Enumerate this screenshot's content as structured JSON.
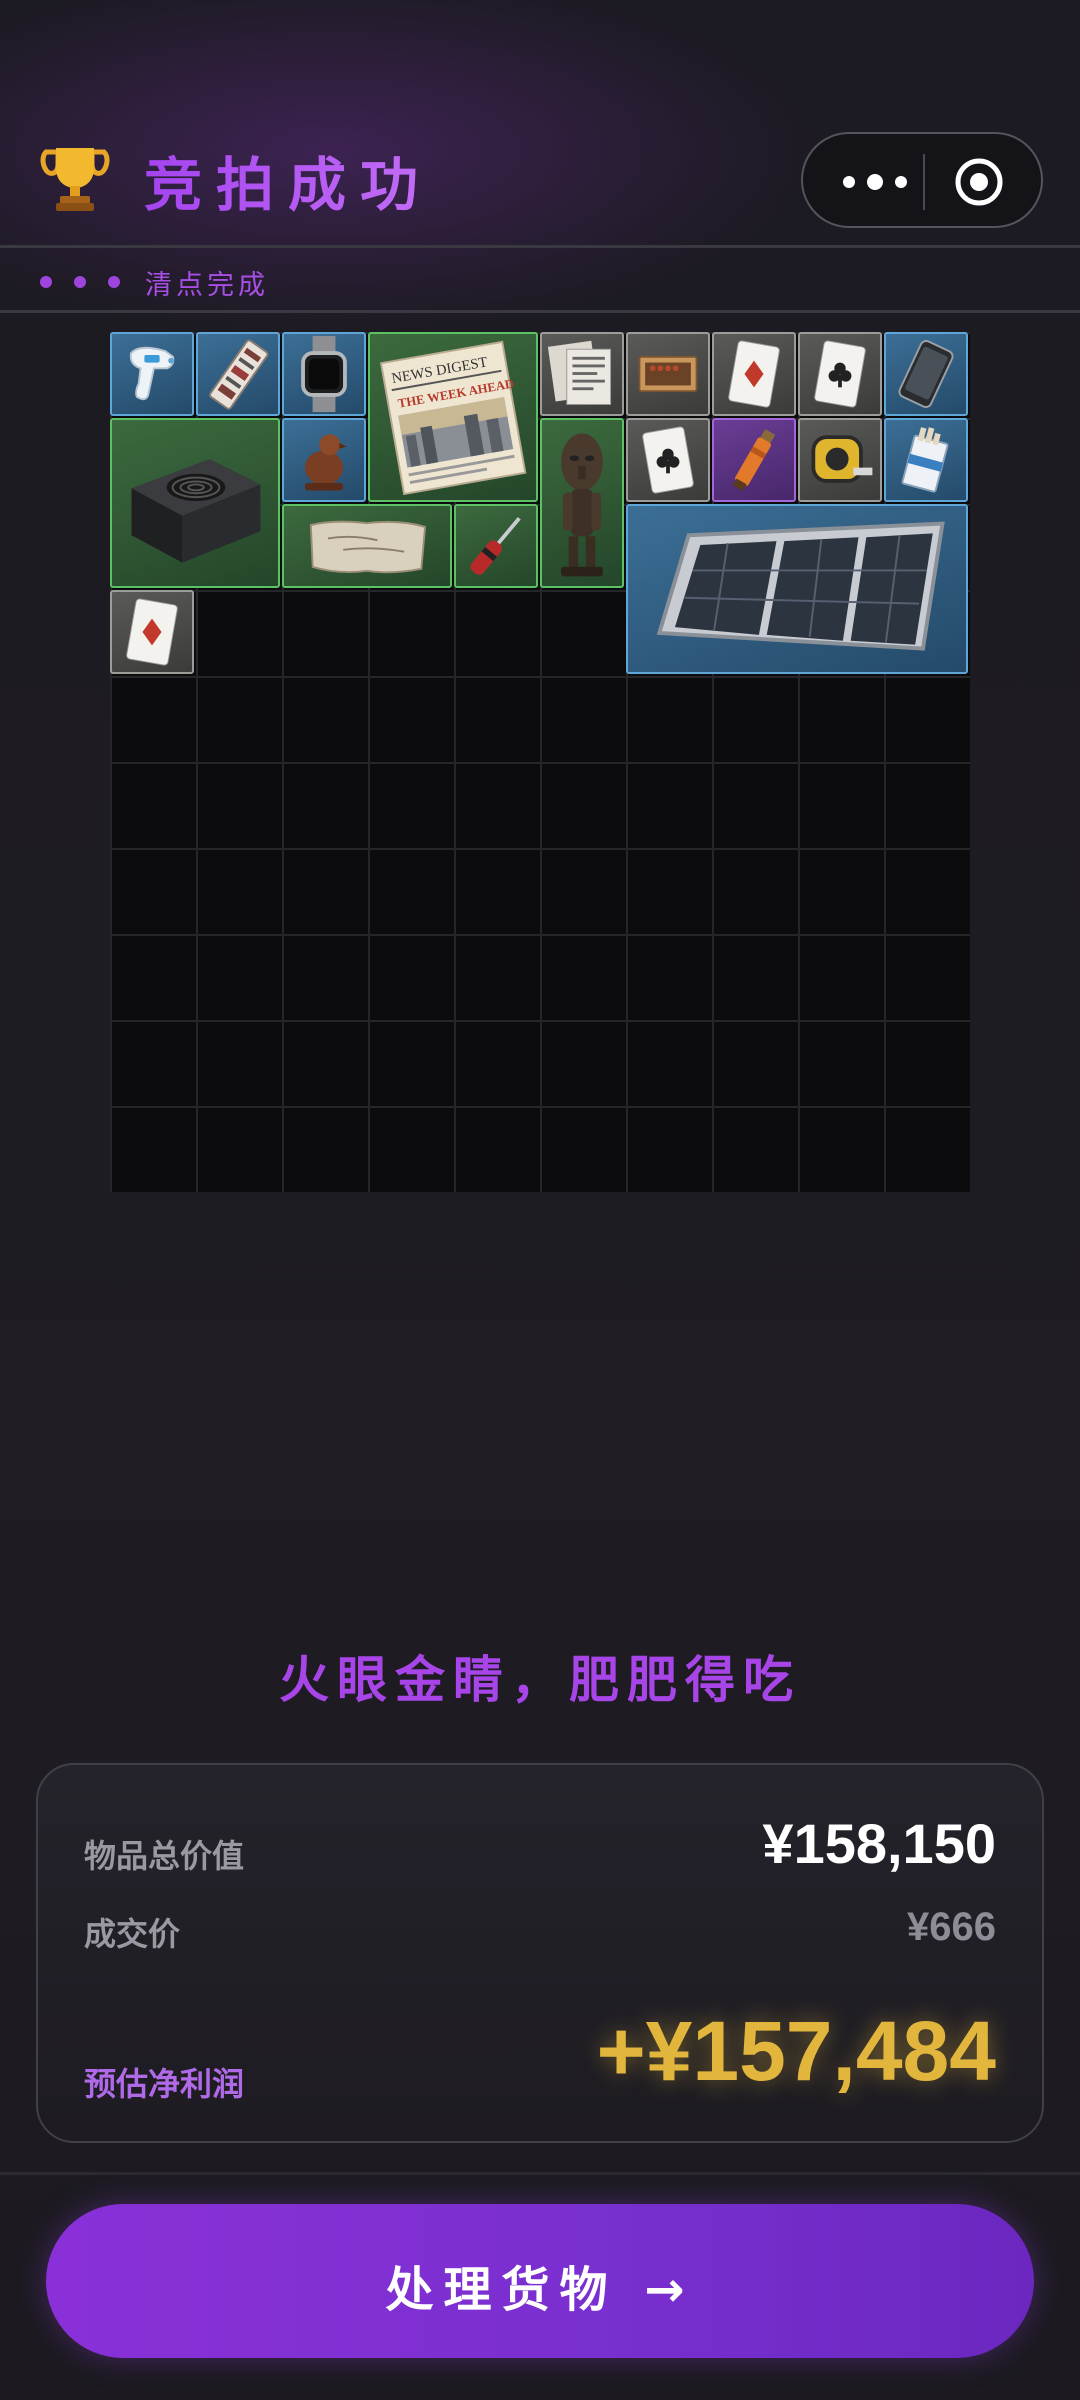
{
  "header": {
    "title": "竞拍成功",
    "trophy_icon": "trophy-icon",
    "menu_icon": "more-dots-icon",
    "close_icon": "target-close-icon",
    "status_text": "清点完成"
  },
  "grid": {
    "columns": 10,
    "rows": 10,
    "items": [
      {
        "name": "thermometer-gun",
        "rarity": "blue"
      },
      {
        "name": "circuit-board",
        "rarity": "blue"
      },
      {
        "name": "smart-watch",
        "rarity": "blue"
      },
      {
        "name": "newspaper",
        "rarity": "green",
        "printed_text": [
          "NEWS DIGEST",
          "THE WEEK AHEAD"
        ]
      },
      {
        "name": "ticket-stack",
        "rarity": "gray"
      },
      {
        "name": "matchbox",
        "rarity": "gray"
      },
      {
        "name": "playing-card-diamond",
        "rarity": "gray"
      },
      {
        "name": "playing-card-club",
        "rarity": "gray"
      },
      {
        "name": "phone",
        "rarity": "blue"
      },
      {
        "name": "power-supply-unit",
        "rarity": "green"
      },
      {
        "name": "wooden-bird",
        "rarity": "blue"
      },
      {
        "name": "tribal-statue",
        "rarity": "green"
      },
      {
        "name": "playing-card-club-2",
        "rarity": "gray"
      },
      {
        "name": "flashlight",
        "rarity": "purple"
      },
      {
        "name": "tape-measure",
        "rarity": "gray"
      },
      {
        "name": "cigarette-pack",
        "rarity": "blue"
      },
      {
        "name": "old-parchment",
        "rarity": "green"
      },
      {
        "name": "screwdriver",
        "rarity": "green"
      },
      {
        "name": "solar-panel",
        "rarity": "blue"
      },
      {
        "name": "playing-card-diamond-2",
        "rarity": "gray"
      }
    ]
  },
  "slogan": "火眼金睛，肥肥得吃",
  "summary": {
    "total_label": "物品总价值",
    "total_value": "¥158,150",
    "deal_label": "成交价",
    "deal_value": "¥666",
    "profit_label": "预估净利润",
    "profit_value": "+¥157,484"
  },
  "cta": {
    "label": "处理货物 →"
  },
  "colors": {
    "accent_purple": "#a745e8",
    "profit_gold": "#e2b63c",
    "rarity_blue": "#5fa6d8",
    "rarity_green": "#5cc064",
    "rarity_gray": "#9c9c98",
    "rarity_purple": "#a166d8"
  }
}
